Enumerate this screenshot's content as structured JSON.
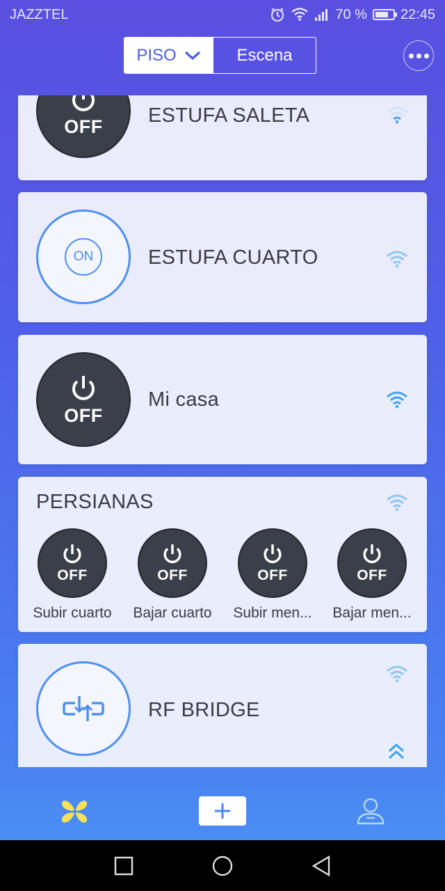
{
  "status_bar": {
    "carrier": "JAZZTEL",
    "battery": "70 %",
    "time": "22:45"
  },
  "header": {
    "tab_piso": "PISO",
    "tab_escena": "Escena"
  },
  "devices": [
    {
      "name": "ESTUFA SALETA",
      "state": "OFF"
    },
    {
      "name": "ESTUFA CUARTO",
      "state": "ON"
    },
    {
      "name": "Mi casa",
      "state": "OFF"
    },
    {
      "name": "PERSIANAS",
      "subs": [
        {
          "label": "Subir cuarto",
          "state": "OFF"
        },
        {
          "label": "Bajar cuarto",
          "state": "OFF"
        },
        {
          "label": "Subir men...",
          "state": "OFF"
        },
        {
          "label": "Bajar men...",
          "state": "OFF"
        }
      ]
    },
    {
      "name": "RF BRIDGE"
    }
  ],
  "colors": {
    "accent": "#4d8ff0",
    "off_button": "#3b3f4a",
    "nav_yellow": "#f5e25a"
  }
}
